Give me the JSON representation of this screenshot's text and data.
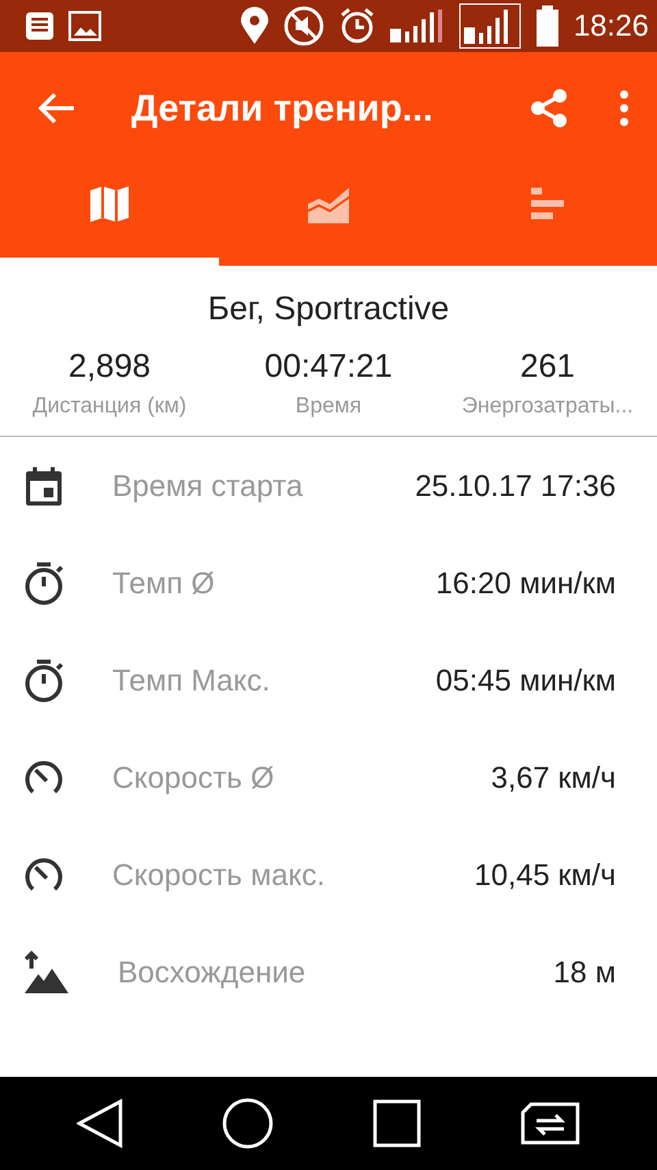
{
  "status_bar": {
    "time": "18:26"
  },
  "toolbar": {
    "title": "Детали тренир..."
  },
  "tabs": [
    {
      "kind": "map",
      "selected": true
    },
    {
      "kind": "chart",
      "selected": false
    },
    {
      "kind": "bars",
      "selected": false
    }
  ],
  "summary": {
    "title": "Бег, Sportractive",
    "stats": [
      {
        "value": "2,898",
        "label": "Дистанция (км)"
      },
      {
        "value": "00:47:21",
        "label": "Время"
      },
      {
        "value": "261",
        "label": "Энергозатраты..."
      }
    ]
  },
  "details": [
    {
      "kind": "calendar",
      "label": "Время старта",
      "value": "25.10.17 17:36"
    },
    {
      "kind": "stopwatch",
      "label": "Темп Ø",
      "value": "16:20 мин/км"
    },
    {
      "kind": "stopwatch",
      "label": "Темп Макс.",
      "value": "05:45 мин/км"
    },
    {
      "kind": "speedometer",
      "label": "Скорость Ø",
      "value": "3,67 км/ч"
    },
    {
      "kind": "speedometer",
      "label": "Скорость макс.",
      "value": "10,45 км/ч"
    },
    {
      "kind": "ascent",
      "label": "Восхождение",
      "value": "18 м"
    }
  ]
}
